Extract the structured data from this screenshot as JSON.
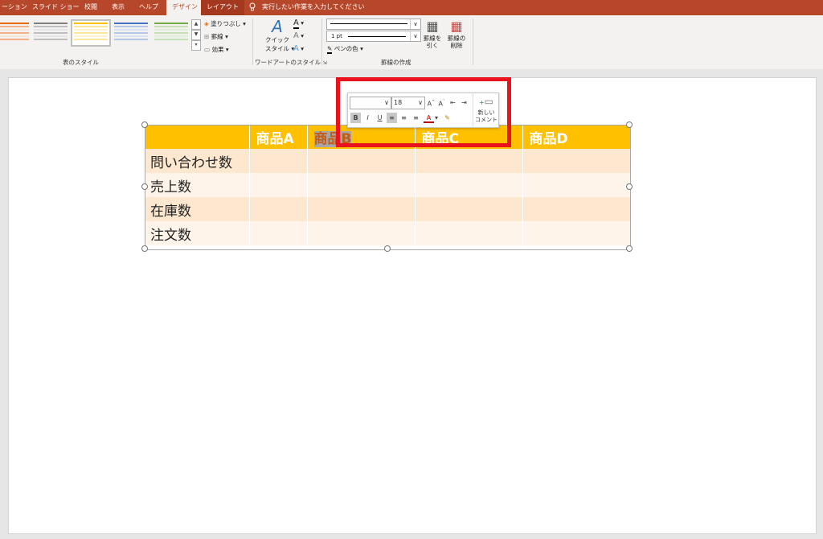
{
  "tabs": [
    {
      "label": "ーション"
    },
    {
      "label": "スライド ショー"
    },
    {
      "label": "校閲"
    },
    {
      "label": "表示"
    },
    {
      "label": "ヘルプ"
    },
    {
      "label": "デザイン"
    },
    {
      "label": "レイアウト"
    }
  ],
  "tell_me": "実行したい作業を入力してください",
  "ribbon": {
    "shading": "塗りつぶし",
    "borders": "罫線",
    "effects": "効果",
    "table_styles_label": "表のスタイル",
    "quick_styles_line1": "クイック",
    "quick_styles_line2": "スタイル",
    "wordart_label": "ワードアートのスタイル",
    "pen_weight": "1 pt",
    "pen_color": "ペンの色",
    "draw_table_line1": "罫線を",
    "draw_table_line2": "引く",
    "eraser_line1": "罫線の",
    "eraser_line2": "削除",
    "draw_borders_label": "罫線の作成",
    "colors": {
      "tab_bg": "#b7472a",
      "accent": "#ffc000"
    }
  },
  "table": {
    "headers": [
      "",
      "商品A",
      "商品B",
      "商品C",
      "商品D"
    ],
    "rows": [
      [
        "問い合わせ数",
        "",
        "",
        "",
        ""
      ],
      [
        "売上数",
        "",
        "",
        "",
        ""
      ],
      [
        "在庫数",
        "",
        "",
        "",
        ""
      ],
      [
        "注文数",
        "",
        "",
        "",
        ""
      ]
    ]
  },
  "mini_toolbar": {
    "font_name": "",
    "font_size": "18",
    "bold": "B",
    "italic": "I",
    "underline": "U",
    "new_comment_line1": "新しい",
    "new_comment_line2": "コメント"
  }
}
